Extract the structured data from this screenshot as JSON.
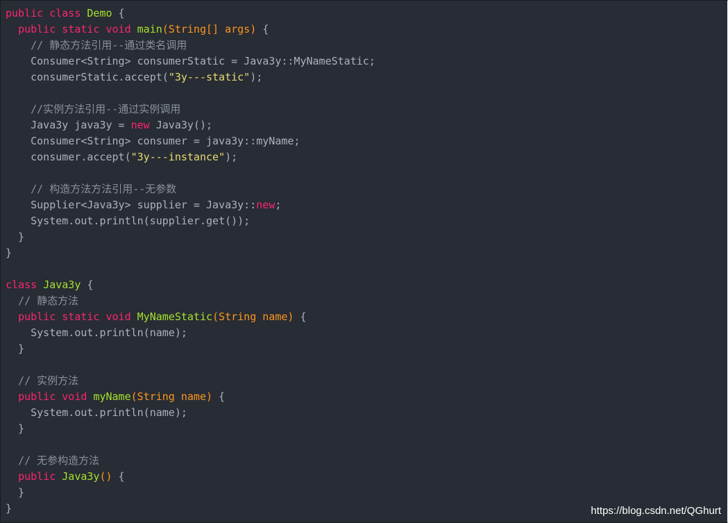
{
  "colors": {
    "background": "#282c34",
    "plain": "#abb2bf",
    "keyword": "#f92672",
    "class_name": "#a6e22e",
    "method_name": "#a6e22e",
    "parameter": "#fd971f",
    "string": "#e6db74",
    "comment": "#8a919c",
    "watermark": "#ffffff"
  },
  "code": {
    "lines": [
      [
        [
          "kw",
          "public class "
        ],
        [
          "class",
          "Demo"
        ],
        [
          "plain",
          " {"
        ]
      ],
      [
        [
          "plain",
          "  "
        ],
        [
          "kw",
          "public static void "
        ],
        [
          "fn",
          "main"
        ],
        [
          "param",
          "(String[] args)"
        ],
        [
          "plain",
          " {"
        ]
      ],
      [
        [
          "plain",
          "    "
        ],
        [
          "comment",
          "// 静态方法引用--通过类名调用"
        ]
      ],
      [
        [
          "plain",
          "    Consumer<String> consumerStatic = Java3y::MyNameStatic;"
        ]
      ],
      [
        [
          "plain",
          "    consumerStatic.accept("
        ],
        [
          "str",
          "\"3y---static\""
        ],
        [
          "plain",
          ");"
        ]
      ],
      [
        [
          "plain",
          ""
        ]
      ],
      [
        [
          "plain",
          "    "
        ],
        [
          "comment",
          "//实例方法引用--通过实例调用"
        ]
      ],
      [
        [
          "plain",
          "    Java3y java3y = "
        ],
        [
          "kw",
          "new"
        ],
        [
          "plain",
          " Java3y();"
        ]
      ],
      [
        [
          "plain",
          "    Consumer<String> consumer = java3y::myName;"
        ]
      ],
      [
        [
          "plain",
          "    consumer.accept("
        ],
        [
          "str",
          "\"3y---instance\""
        ],
        [
          "plain",
          ");"
        ]
      ],
      [
        [
          "plain",
          ""
        ]
      ],
      [
        [
          "plain",
          "    "
        ],
        [
          "comment",
          "// 构造方法方法引用--无参数"
        ]
      ],
      [
        [
          "plain",
          "    Supplier<Java3y> supplier = Java3y::"
        ],
        [
          "kw",
          "new"
        ],
        [
          "plain",
          ";"
        ]
      ],
      [
        [
          "plain",
          "    System.out.println(supplier.get());"
        ]
      ],
      [
        [
          "plain",
          "  }"
        ]
      ],
      [
        [
          "plain",
          "}"
        ]
      ],
      [
        [
          "plain",
          ""
        ]
      ],
      [
        [
          "kw",
          "class "
        ],
        [
          "class",
          "Java3y"
        ],
        [
          "plain",
          " {"
        ]
      ],
      [
        [
          "plain",
          "  "
        ],
        [
          "comment",
          "// 静态方法"
        ]
      ],
      [
        [
          "plain",
          "  "
        ],
        [
          "kw",
          "public static void "
        ],
        [
          "fn",
          "MyNameStatic"
        ],
        [
          "param",
          "(String name)"
        ],
        [
          "plain",
          " {"
        ]
      ],
      [
        [
          "plain",
          "    System.out.println(name);"
        ]
      ],
      [
        [
          "plain",
          "  }"
        ]
      ],
      [
        [
          "plain",
          ""
        ]
      ],
      [
        [
          "plain",
          "  "
        ],
        [
          "comment",
          "// 实例方法"
        ]
      ],
      [
        [
          "plain",
          "  "
        ],
        [
          "kw",
          "public void "
        ],
        [
          "fn",
          "myName"
        ],
        [
          "param",
          "(String name)"
        ],
        [
          "plain",
          " {"
        ]
      ],
      [
        [
          "plain",
          "    System.out.println(name);"
        ]
      ],
      [
        [
          "plain",
          "  }"
        ]
      ],
      [
        [
          "plain",
          ""
        ]
      ],
      [
        [
          "plain",
          "  "
        ],
        [
          "comment",
          "// 无参构造方法"
        ]
      ],
      [
        [
          "plain",
          "  "
        ],
        [
          "kw",
          "public "
        ],
        [
          "fn",
          "Java3y"
        ],
        [
          "param",
          "()"
        ],
        [
          "plain",
          " {"
        ]
      ],
      [
        [
          "plain",
          "  }"
        ]
      ],
      [
        [
          "plain",
          "}"
        ]
      ]
    ]
  },
  "watermark": {
    "text": "https://blog.csdn.net/QGhurt"
  }
}
